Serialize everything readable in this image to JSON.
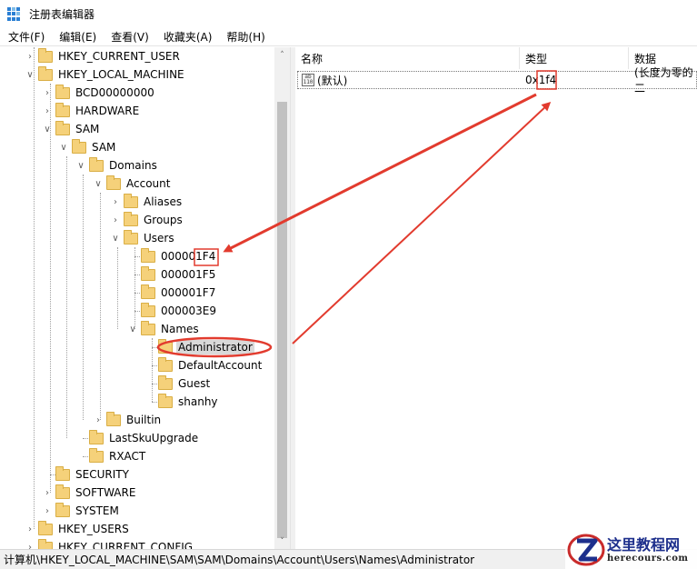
{
  "window": {
    "title": "注册表编辑器"
  },
  "menu": [
    "文件(F)",
    "编辑(E)",
    "查看(V)",
    "收藏夹(A)",
    "帮助(H)"
  ],
  "tree": {
    "hkcu": "HKEY_CURRENT_USER",
    "hklm": "HKEY_LOCAL_MACHINE",
    "bcd": "BCD00000000",
    "hardware": "HARDWARE",
    "sam": "SAM",
    "sam2": "SAM",
    "domains": "Domains",
    "account": "Account",
    "aliases": "Aliases",
    "groups": "Groups",
    "users": "Users",
    "u1": "000001F4",
    "u2": "000001F5",
    "u3": "000001F7",
    "u4": "000003E9",
    "names": "Names",
    "administrator": "Administrator",
    "defaultaccount": "DefaultAccount",
    "guest": "Guest",
    "shanhy": "shanhy",
    "builtin": "Builtin",
    "lastsku": "LastSkuUpgrade",
    "rxact": "RXACT",
    "security": "SECURITY",
    "software": "SOFTWARE",
    "system": "SYSTEM",
    "hku": "HKEY_USERS",
    "hkcc": "HKEY_CURRENT_CONFIG"
  },
  "values": {
    "headers": {
      "name": "名称",
      "type": "类型",
      "data": "数据"
    },
    "rows": [
      {
        "name": "(默认)",
        "type": "0x1f4",
        "data": "(长度为零的二"
      }
    ],
    "icon_text": [
      "ab",
      "110"
    ]
  },
  "status": {
    "path": "计算机\\HKEY_LOCAL_MACHINE\\SAM\\SAM\\Domains\\Account\\Users\\Names\\Administrator"
  },
  "watermark": {
    "name": "这里教程网",
    "url": "herecours.com"
  },
  "colors": {
    "annotation": "#e23b2e",
    "folder": "#f5d17a",
    "watermark_blue": "#1d2f8c"
  }
}
